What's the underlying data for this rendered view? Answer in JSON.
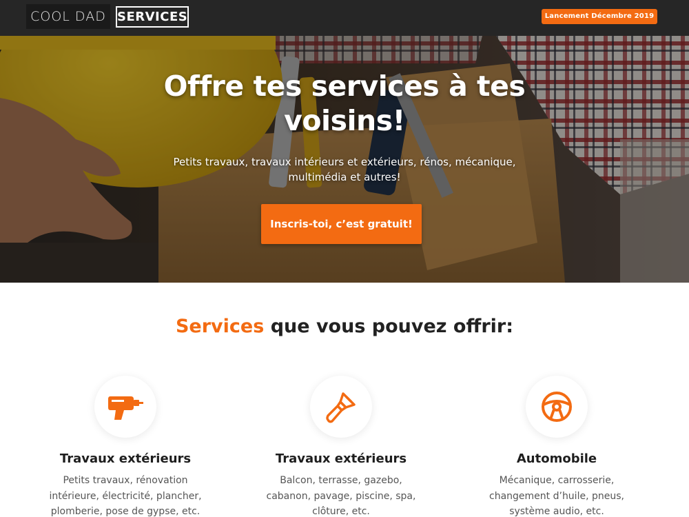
{
  "header": {
    "logo_part1": "COOL DAD",
    "logo_part2": "SERVICES",
    "launch_badge": "Lancement Décembre 2019"
  },
  "hero": {
    "title_line1": "Offre tes services à tes",
    "title_line2": "voisins!",
    "subtitle": "Petits travaux, travaux intérieurs et extérieurs, rénos, mécanique, multimédia et autres!",
    "cta_label": "Inscris-toi, c’est gratuit!"
  },
  "services_section": {
    "title_accent": "Services",
    "title_rest": "que vous pouvez offrir:"
  },
  "services": [
    {
      "icon": "drill-icon",
      "title": "Travaux extérieurs",
      "description": "Petits travaux, rénovation intérieure, électricité, plancher, plomberie, pose de gypse, etc."
    },
    {
      "icon": "paint-brush-icon",
      "title": "Travaux extérieurs",
      "description": "Balcon, terrasse, gazebo, cabanon, pavage, piscine, spa, clôture, etc."
    },
    {
      "icon": "steering-wheel-icon",
      "title": "Automobile",
      "description": "Mécanique, carrosserie, changement d’huile, pneus, système audio, etc."
    }
  ],
  "colors": {
    "accent": "#f36b12",
    "topbar": "#262626",
    "text_dark": "#222222",
    "text_body": "#555555"
  }
}
